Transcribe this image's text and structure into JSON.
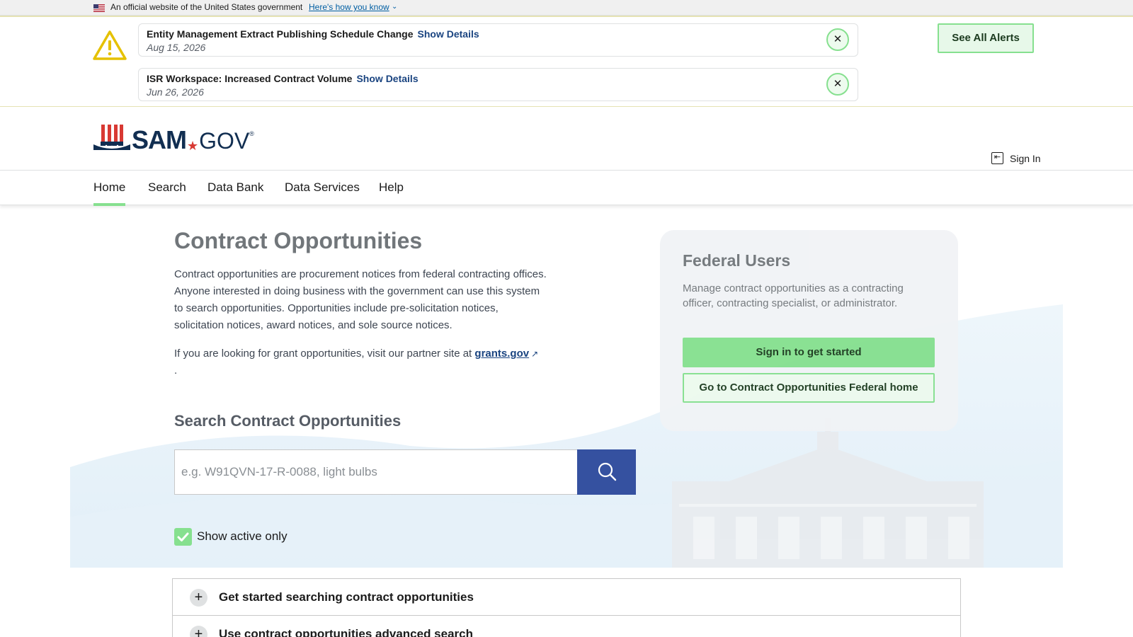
{
  "gov_banner": {
    "text": "An official website of the United States government",
    "link": "Here's how you know"
  },
  "alerts": [
    {
      "title": "Entity Management Extract Publishing Schedule Change",
      "action": "Show Details",
      "date": "Aug 15, 2026"
    },
    {
      "title": "ISR Workspace: Increased Contract Volume",
      "action": "Show Details",
      "date": "Jun 26, 2026"
    }
  ],
  "alerts_button": "See All Alerts",
  "header": {
    "logo_sam": "SAM",
    "logo_gov": "GOV",
    "signin_label": "Sign In"
  },
  "nav": {
    "items": [
      "Home",
      "Search",
      "Data Bank",
      "Data Services",
      "Help"
    ],
    "active": "Home"
  },
  "main": {
    "title": "Contract Opportunities",
    "intro": "Contract opportunities are procurement notices from federal contracting offices. Anyone interested in doing business with the government can use this system to search opportunities. Opportunities include pre-solicitation notices, solicitation notices, award notices, and sole source notices.",
    "grant_text": "If you are looking for grant opportunities, visit our partner site at",
    "grant_link": "grants.gov",
    "grant_suffix": ".",
    "search_heading": "Search Contract Opportunities",
    "search_placeholder": "e.g. W91QVN-17-R-0088, light bulbs",
    "search_value": "",
    "active_only_label": "Show active only",
    "active_only_checked": true
  },
  "federal_card": {
    "title": "Federal Users",
    "description": "Manage contract opportunities as a contracting officer, contracting specialist, or administrator.",
    "primary_button": "Sign in to get started",
    "secondary_button": "Go to Contract Opportunities Federal home"
  },
  "accordion": [
    {
      "label": "Get started searching contract opportunities"
    },
    {
      "label": "Use contract opportunities advanced search"
    }
  ],
  "colors": {
    "accent_green": "#86e08f",
    "primary_blue": "#3551a0",
    "link_blue": "#1a4480",
    "brand_navy": "#112e51",
    "brand_red": "#d83933"
  },
  "icons": {
    "flag": "us-flag-icon",
    "warning": "warning-triangle-icon",
    "close": "close-icon",
    "signin": "sign-in-icon",
    "search": "search-icon",
    "check": "checkmark-icon",
    "plus": "plus-icon",
    "external": "external-link-icon"
  }
}
